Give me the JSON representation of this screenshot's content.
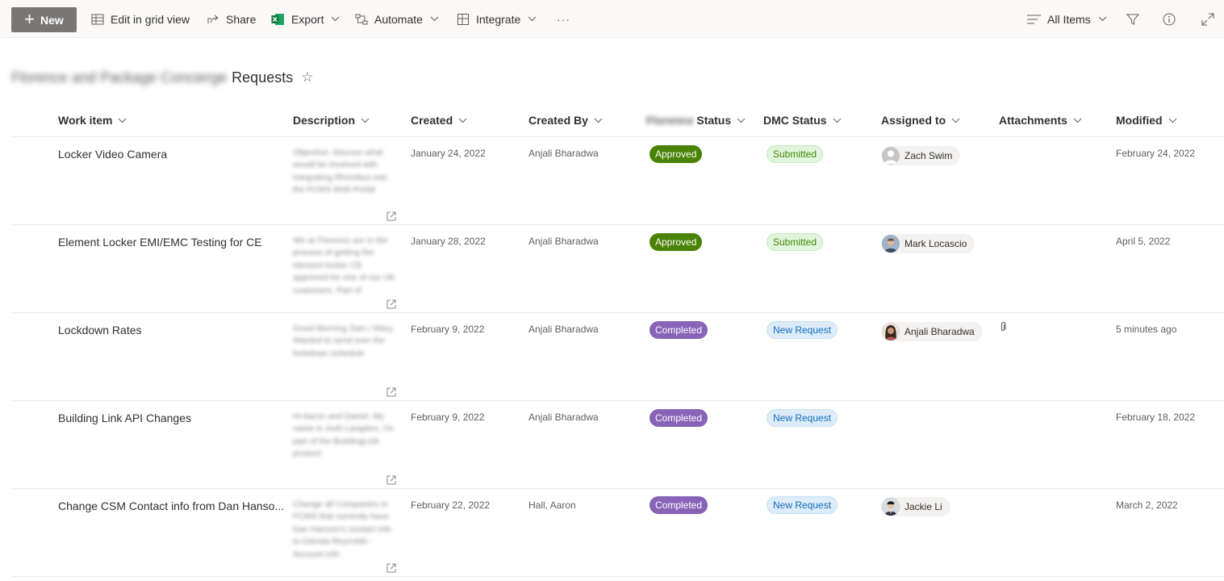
{
  "toolbar": {
    "new_label": "New",
    "edit_grid_label": "Edit in grid view",
    "share_label": "Share",
    "export_label": "Export",
    "automate_label": "Automate",
    "integrate_label": "Integrate",
    "more_label": "···",
    "view_label": "All Items"
  },
  "list": {
    "title_prefix": "Florence and Package Concierge",
    "title": "Requests"
  },
  "columns": {
    "work_item": "Work item",
    "description": "Description",
    "created": "Created",
    "created_by": "Created By",
    "florence_status_prefix": "Florence",
    "florence_status": "Status",
    "dmc_status": "DMC Status",
    "assigned_to": "Assigned to",
    "attachments": "Attachments",
    "modified": "Modified"
  },
  "rows": [
    {
      "work_item": "Locker Video Camera",
      "description": "Objective: Discuss what would be involved with integrating Rhombus into the FCMS Web Portal",
      "created": "January 24, 2022",
      "created_by": "Anjali Bharadwa",
      "florence_status": "Approved",
      "dmc_status": "Submitted",
      "assigned_to": "Zach Swim",
      "attachment": "",
      "modified": "February 24, 2022"
    },
    {
      "work_item": "Element Locker EMI/EMC Testing for CE",
      "description": "We at Florence are in the process of getting the element locker CE approved for one of our UK customers. Part of",
      "created": "January 28, 2022",
      "created_by": "Anjali Bharadwa",
      "florence_status": "Approved",
      "dmc_status": "Submitted",
      "assigned_to": "Mark Locascio",
      "attachment": "",
      "modified": "April 5, 2022"
    },
    {
      "work_item": "Lockdown Rates",
      "description": "Good Morning Sam / Mary, Wanted to send over the lockdown schedule",
      "created": "February 9, 2022",
      "created_by": "Anjali Bharadwa",
      "florence_status": "Completed",
      "dmc_status": "New Request",
      "assigned_to": "Anjali Bharadwa",
      "attachment": "yes",
      "modified": "5 minutes ago"
    },
    {
      "work_item": "Building Link API Changes",
      "description": "Hi Aaron and Daniel, My name is Josh Langdon, I'm part of the BuildingLink product",
      "created": "February 9, 2022",
      "created_by": "Anjali Bharadwa",
      "florence_status": "Completed",
      "dmc_status": "New Request",
      "assigned_to": "",
      "attachment": "",
      "modified": "February 18, 2022"
    },
    {
      "work_item": "Change CSM Contact info from Dan Hanso...",
      "description": "Change all Companies in FCMS that currently have Dan Hanson's contact info to Glenda Reynolds - Account info",
      "created": "February 22, 2022",
      "created_by": "Hall, Aaron",
      "florence_status": "Completed",
      "dmc_status": "New Request",
      "assigned_to": "Jackie Li",
      "attachment": "",
      "modified": "March 2, 2022"
    }
  ],
  "colors": {
    "approved": "#498205",
    "completed": "#8764b8",
    "submitted_bg": "#dff6dd",
    "new_request_bg": "#deecf9",
    "new_button_bg": "#797775"
  },
  "icons": {
    "new": "plus-icon",
    "edit_grid": "grid-icon",
    "share": "share-icon",
    "export": "excel-icon",
    "automate": "flow-icon",
    "integrate": "integrate-icon",
    "view": "view-lines-icon",
    "filter": "filter-icon",
    "info": "info-icon",
    "expand": "expand-icon",
    "favorite": "star-icon",
    "attachment": "paperclip-icon",
    "open_description": "open-external-icon"
  }
}
